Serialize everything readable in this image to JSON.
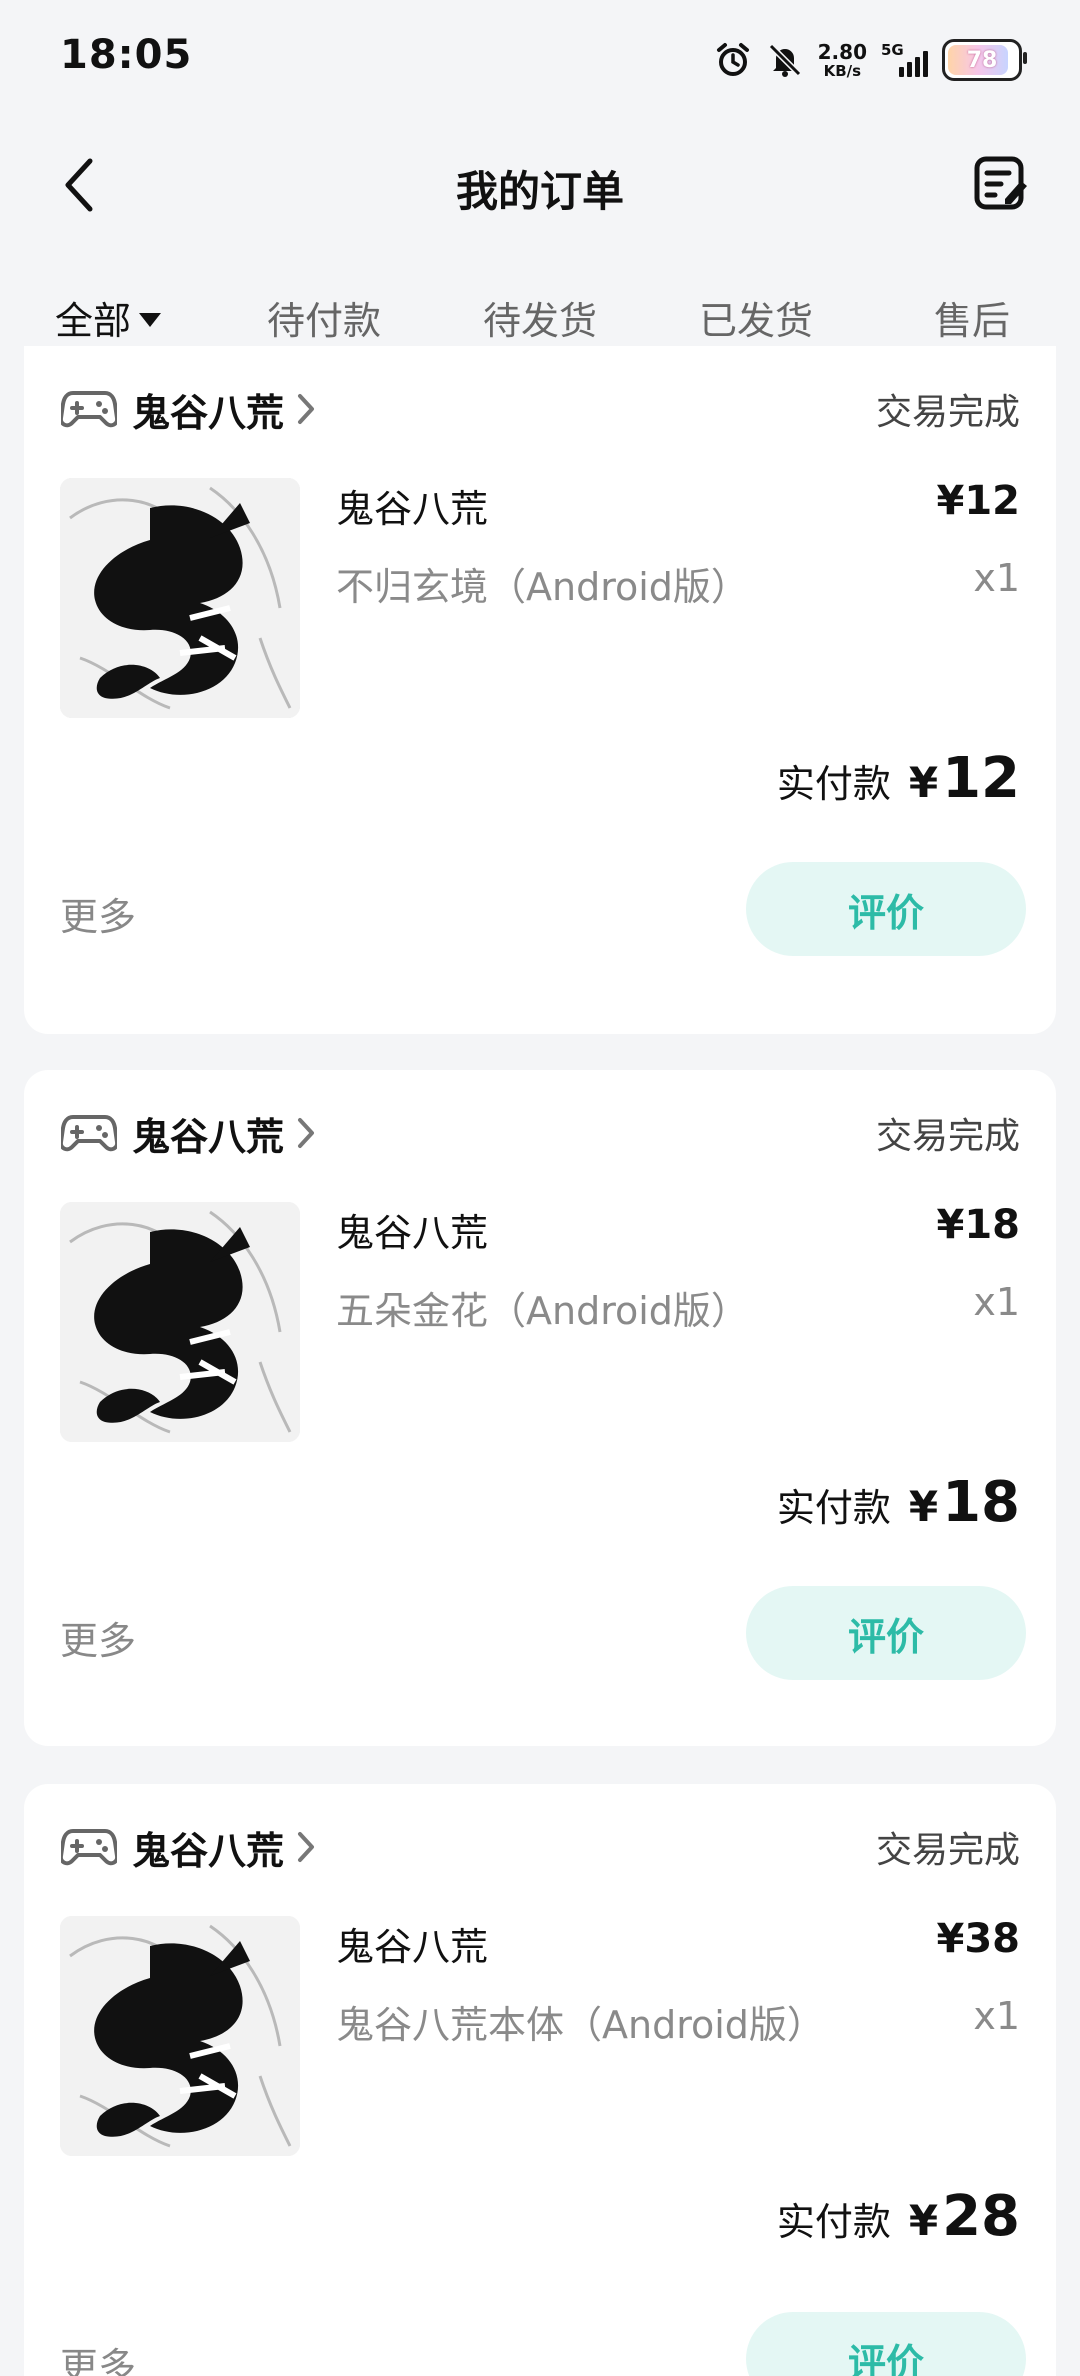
{
  "status_bar": {
    "time": "18:05",
    "speed_value": "2.80",
    "speed_unit": "KB/s",
    "network": "5G",
    "battery": "78",
    "icons": [
      "alarm-icon",
      "bell-muted-icon",
      "signal-icon",
      "battery-icon"
    ]
  },
  "header": {
    "title": "我的订单",
    "back_icon": "chevron-left-icon",
    "action_icon": "edit-list-icon"
  },
  "tabs": [
    {
      "label": "全部",
      "active": true
    },
    {
      "label": "待付款",
      "active": false
    },
    {
      "label": "待发货",
      "active": false
    },
    {
      "label": "已发货",
      "active": false
    },
    {
      "label": "售后",
      "active": false
    }
  ],
  "orders": [
    {
      "shop": "鬼谷八荒",
      "status": "交易完成",
      "product": "鬼谷八荒",
      "sku": "不归玄境（Android版）",
      "price": "¥12",
      "qty": "x1",
      "paid_label": "实付款",
      "paid_currency": "¥",
      "paid_amount": "12",
      "more": "更多",
      "action": "评价"
    },
    {
      "shop": "鬼谷八荒",
      "status": "交易完成",
      "product": "鬼谷八荒",
      "sku": "五朵金花（Android版）",
      "price": "¥18",
      "qty": "x1",
      "paid_label": "实付款",
      "paid_currency": "¥",
      "paid_amount": "18",
      "more": "更多",
      "action": "评价"
    },
    {
      "shop": "鬼谷八荒",
      "status": "交易完成",
      "product": "鬼谷八荒",
      "sku": "鬼谷八荒本体（Android版）",
      "price": "¥38",
      "qty": "x1",
      "paid_label": "实付款",
      "paid_currency": "¥",
      "paid_amount": "28",
      "more": "更多",
      "action": "评价"
    }
  ],
  "colors": {
    "accent": "#2fc4b0",
    "button_bg": "#e4f7f4",
    "page_bg": "#f4f5f7"
  }
}
